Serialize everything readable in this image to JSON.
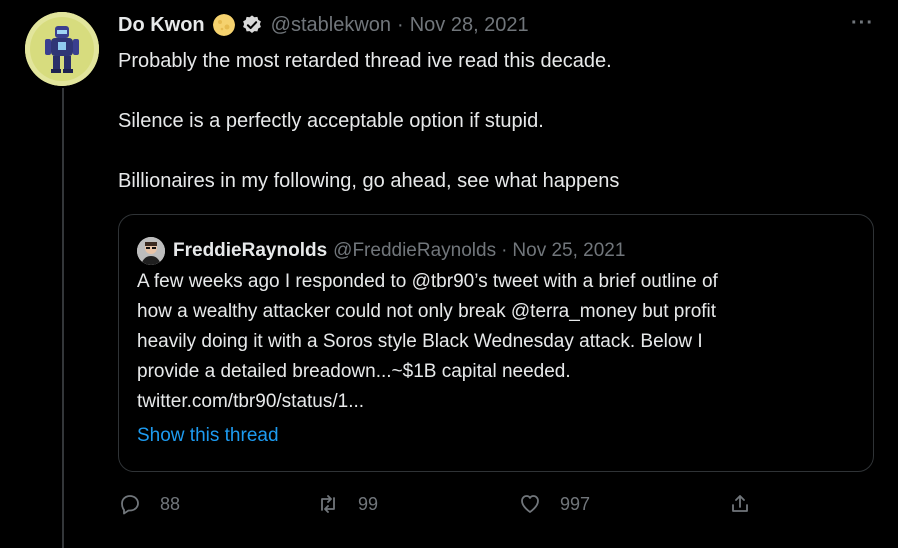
{
  "tweet": {
    "author": {
      "name": "Do Kwon",
      "handle": "@stablekwon",
      "emoji": "moon-emoji",
      "verified": true
    },
    "separator": "·",
    "date": "Nov 28, 2021",
    "more_icon": "···",
    "lines": [
      "Probably the most retarded thread ive read this decade.",
      "",
      "Silence is a perfectly acceptable option if stupid.",
      "",
      "Billionaires in my following, go ahead, see what happens"
    ]
  },
  "quote": {
    "author": {
      "name": "FreddieRaynolds",
      "handle": "@FreddieRaynolds"
    },
    "separator": "·",
    "date": "Nov 25, 2021",
    "lines": [
      "A few weeks ago I responded to @tbr90’s tweet with a brief outline of",
      "how a wealthy attacker could not only break @terra_money but profit",
      "heavily doing it with a Soros style Black Wednesday attack. Below I",
      "provide a detailed breadown...~$1B capital needed.",
      "twitter.com/tbr90/status/1..."
    ],
    "show_thread": "Show this thread"
  },
  "actions": {
    "reply_count": "88",
    "retweet_count": "99",
    "like_count": "997",
    "share_icon": "share-icon"
  },
  "colors": {
    "background": "#000000",
    "text": "#e7e9ea",
    "muted": "#71767b",
    "border": "#2f3336",
    "link": "#1d9bf0",
    "verified_badge": "#d9d9d9"
  }
}
